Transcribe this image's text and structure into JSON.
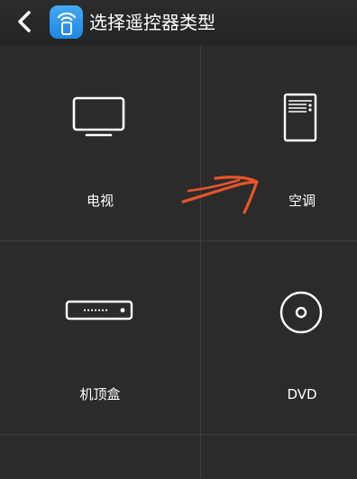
{
  "header": {
    "back_icon": "chevron-left-icon",
    "app_icon": "wifi-remote-icon",
    "title": "选择遥控器类型"
  },
  "remote_types": [
    {
      "label": "电视",
      "icon": "tv-icon"
    },
    {
      "label": "空调",
      "icon": "air-conditioner-icon"
    },
    {
      "label": "机顶盒",
      "icon": "set-top-box-icon"
    },
    {
      "label": "DVD",
      "icon": "disc-icon"
    }
  ],
  "colors": {
    "background": "#2b2b2b",
    "header": "#262626",
    "app_icon_blue": "#2b93e8",
    "divider": "#3d3d3d",
    "annotation_arrow": "#e8542a"
  }
}
